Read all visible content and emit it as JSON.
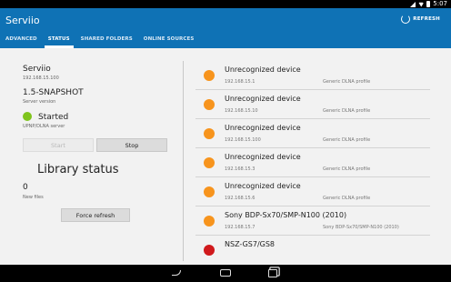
{
  "status_bar": {
    "time": "5:07"
  },
  "action_bar": {
    "title": "Serviio",
    "refresh_label": "REFRESH"
  },
  "tabs": [
    {
      "label": "ADVANCED",
      "active": false
    },
    {
      "label": "STATUS",
      "active": true
    },
    {
      "label": "SHARED FOLDERS",
      "active": false
    },
    {
      "label": "ONLINE SOURCES",
      "active": false
    }
  ],
  "server": {
    "name": "Serviio",
    "ip": "192.168.15.100",
    "version": "1.5-SNAPSHOT",
    "version_label": "Server version",
    "status": "Started",
    "status_label": "UPNP/DLNA server",
    "status_color": "#7fc41d",
    "start_label": "Start",
    "start_enabled": false,
    "stop_label": "Stop"
  },
  "library": {
    "title": "Library status",
    "new_files": "0",
    "new_files_label": "New files",
    "refresh_label": "Force refresh"
  },
  "colors": {
    "accent": "#0f72b5",
    "device_active": "#f7941d",
    "device_inactive": "#d0191c"
  },
  "devices": [
    {
      "name": "Unrecognized device",
      "ip": "192.168.15.1",
      "profile": "Generic DLNA profile",
      "color": "#f7941d"
    },
    {
      "name": "Unrecognized device",
      "ip": "192.168.15.10",
      "profile": "Generic DLNA profile",
      "color": "#f7941d"
    },
    {
      "name": "Unrecognized device",
      "ip": "192.168.15.100",
      "profile": "Generic DLNA profile",
      "color": "#f7941d"
    },
    {
      "name": "Unrecognized device",
      "ip": "192.168.15.3",
      "profile": "Generic DLNA profile",
      "color": "#f7941d"
    },
    {
      "name": "Unrecognized device",
      "ip": "192.168.15.6",
      "profile": "Generic DLNA profile",
      "color": "#f7941d"
    },
    {
      "name": "Sony BDP-Sx70/SMP-N100 (2010)",
      "ip": "192.168.15.7",
      "profile": "Sony BDP-Sx70/SMP-N100 (2010)",
      "color": "#f7941d"
    },
    {
      "name": "NSZ-GS7/GS8",
      "ip": "",
      "profile": "",
      "color": "#d0191c"
    }
  ]
}
